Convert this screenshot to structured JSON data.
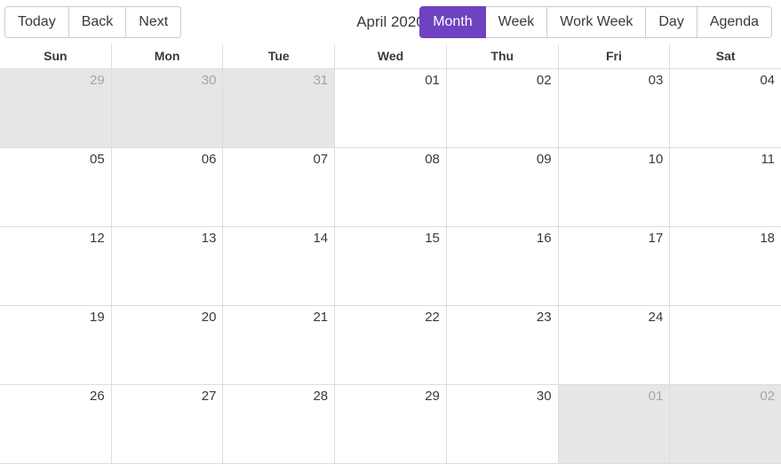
{
  "toolbar": {
    "nav_buttons": [
      {
        "label": "Today",
        "name": "today-button"
      },
      {
        "label": "Back",
        "name": "back-button"
      },
      {
        "label": "Next",
        "name": "next-button"
      }
    ],
    "current_range_label": "April 2020",
    "view_buttons": [
      {
        "label": "Month",
        "name": "view-month-button",
        "active": true
      },
      {
        "label": "Week",
        "name": "view-week-button",
        "active": false
      },
      {
        "label": "Work Week",
        "name": "view-work-week-button",
        "active": false
      },
      {
        "label": "Day",
        "name": "view-day-button",
        "active": false
      },
      {
        "label": "Agenda",
        "name": "view-agenda-button",
        "active": false
      }
    ],
    "active_view": "Month",
    "accent_color": "#6f42c1"
  },
  "calendar": {
    "day_headers": [
      "Sun",
      "Mon",
      "Tue",
      "Wed",
      "Thu",
      "Fri",
      "Sat"
    ],
    "off_month_background": "#e6e6e6",
    "off_month_text_color": "#a6a6a6",
    "border_color": "#dddddd",
    "weeks": [
      [
        {
          "label": "29",
          "off_month": true
        },
        {
          "label": "30",
          "off_month": true
        },
        {
          "label": "31",
          "off_month": true
        },
        {
          "label": "01",
          "off_month": false
        },
        {
          "label": "02",
          "off_month": false
        },
        {
          "label": "03",
          "off_month": false
        },
        {
          "label": "04",
          "off_month": false
        }
      ],
      [
        {
          "label": "05",
          "off_month": false
        },
        {
          "label": "06",
          "off_month": false
        },
        {
          "label": "07",
          "off_month": false
        },
        {
          "label": "08",
          "off_month": false
        },
        {
          "label": "09",
          "off_month": false
        },
        {
          "label": "10",
          "off_month": false
        },
        {
          "label": "11",
          "off_month": false
        }
      ],
      [
        {
          "label": "12",
          "off_month": false
        },
        {
          "label": "13",
          "off_month": false
        },
        {
          "label": "14",
          "off_month": false
        },
        {
          "label": "15",
          "off_month": false
        },
        {
          "label": "16",
          "off_month": false
        },
        {
          "label": "17",
          "off_month": false
        },
        {
          "label": "18",
          "off_month": false
        }
      ],
      [
        {
          "label": "19",
          "off_month": false
        },
        {
          "label": "20",
          "off_month": false
        },
        {
          "label": "21",
          "off_month": false
        },
        {
          "label": "22",
          "off_month": false
        },
        {
          "label": "23",
          "off_month": false
        },
        {
          "label": "24",
          "off_month": false
        },
        {
          "label": "",
          "off_month": false
        }
      ],
      [
        {
          "label": "26",
          "off_month": false
        },
        {
          "label": "27",
          "off_month": false
        },
        {
          "label": "28",
          "off_month": false
        },
        {
          "label": "29",
          "off_month": false
        },
        {
          "label": "30",
          "off_month": false
        },
        {
          "label": "01",
          "off_month": true
        },
        {
          "label": "02",
          "off_month": true
        }
      ]
    ]
  }
}
